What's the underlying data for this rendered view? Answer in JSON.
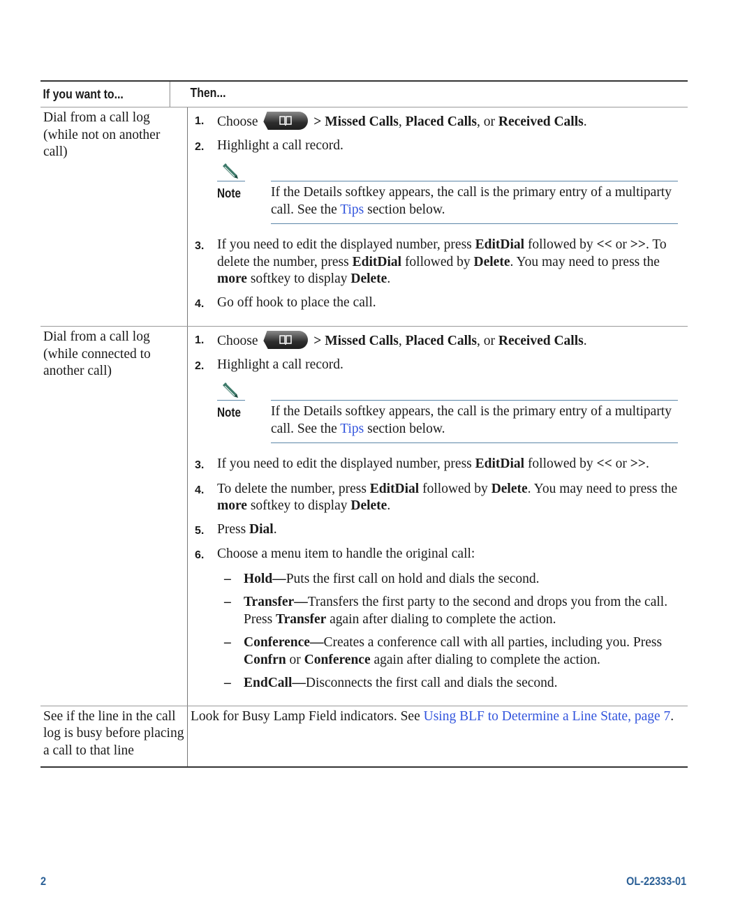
{
  "table": {
    "headers": [
      "If you want to...",
      "Then..."
    ],
    "rows": [
      {
        "task": "Dial from a call log (while not on another call)",
        "steps": [
          {
            "num": "1.",
            "pre": "Choose",
            "icon": "directories-button-icon",
            "bold1": "> Missed Calls",
            "sep1": ", ",
            "bold2": "Placed Calls",
            "sep2": ", or ",
            "bold3": "Received Calls",
            "end": "."
          },
          {
            "num": "2.",
            "text": "Highlight a call record."
          },
          {
            "num": "3.",
            "parts": [
              "If you need to edit the displayed number, press ",
              "EditDial",
              " followed by ",
              "<<",
              " or ",
              ">>",
              ". To delete the number, press ",
              "EditDial",
              " followed by ",
              "Delete",
              ". You may need to press the ",
              "more",
              " softkey to display ",
              "Delete",
              "."
            ]
          },
          {
            "num": "4.",
            "text": "Go off hook to place the call."
          }
        ],
        "note": {
          "label": "Note",
          "pre": "If the Details softkey appears, the call is the primary entry of a multiparty call. See the ",
          "link": "Tips",
          "post": " section below."
        }
      },
      {
        "task": "Dial from a call log (while connected to another call)",
        "steps": [
          {
            "num": "1.",
            "pre": "Choose",
            "icon": "directories-button-icon",
            "bold1": "> Missed Calls",
            "sep1": ", ",
            "bold2": "Placed Calls",
            "sep2": ", or ",
            "bold3": "Received Calls",
            "end": "."
          },
          {
            "num": "2.",
            "text": "Highlight a call record."
          },
          {
            "num": "3.",
            "parts": [
              "If you need to edit the displayed number, press ",
              "EditDial",
              " followed by ",
              "<<",
              " or ",
              ">>",
              "."
            ]
          },
          {
            "num": "4.",
            "parts": [
              "To delete the number, press ",
              "EditDial",
              " followed by ",
              "Delete",
              ". You may need to press the ",
              "more",
              " softkey to display ",
              "Delete",
              "."
            ]
          },
          {
            "num": "5.",
            "parts": [
              "Press ",
              "Dial",
              "."
            ]
          },
          {
            "num": "6.",
            "text": "Choose a menu item to handle the original call:"
          }
        ],
        "note": {
          "label": "Note",
          "pre": "If the Details softkey appears, the call is the primary entry of a multiparty call. See the ",
          "link": "Tips",
          "post": " section below."
        },
        "options": [
          {
            "dash": "–",
            "parts": [
              "Hold—",
              "Puts the first call on hold and dials the second."
            ]
          },
          {
            "dash": "–",
            "parts": [
              "Transfer—",
              "Transfers the first party to the second and drops you from the call. Press ",
              "Transfer",
              " again after dialing to complete the action."
            ]
          },
          {
            "dash": "–",
            "parts": [
              "Conference—",
              "Creates a conference call with all parties, including you. Press ",
              "Confrn",
              " or ",
              "Conference",
              " again after dialing to complete the action."
            ]
          },
          {
            "dash": "–",
            "parts": [
              "EndCall—",
              "Disconnects the first call and dials the second."
            ]
          }
        ]
      },
      {
        "task": "See if the line in the call log is busy before placing a call to that line",
        "pre": "Look for Busy Lamp Field indicators. See ",
        "link": "Using BLF to Determine a Line State, page 7",
        "post": "."
      }
    ]
  },
  "footer": {
    "page_number": "2",
    "doc_id": "OL-22333-01"
  },
  "colors": {
    "link": "#3355dd",
    "footer": "#2a5f96",
    "note_rule": "#5b86a8"
  }
}
